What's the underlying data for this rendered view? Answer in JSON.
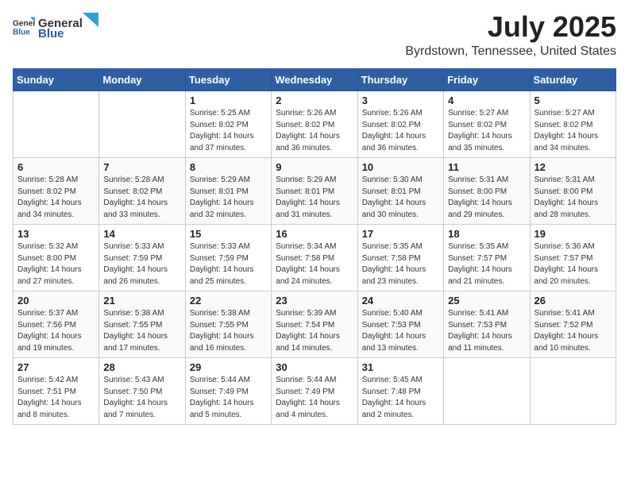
{
  "header": {
    "logo_general": "General",
    "logo_blue": "Blue",
    "month": "July 2025",
    "location": "Byrdstown, Tennessee, United States"
  },
  "weekdays": [
    "Sunday",
    "Monday",
    "Tuesday",
    "Wednesday",
    "Thursday",
    "Friday",
    "Saturday"
  ],
  "weeks": [
    [
      null,
      null,
      {
        "day": "1",
        "sunrise": "5:25 AM",
        "sunset": "8:02 PM",
        "daylight": "14 hours and 37 minutes."
      },
      {
        "day": "2",
        "sunrise": "5:26 AM",
        "sunset": "8:02 PM",
        "daylight": "14 hours and 36 minutes."
      },
      {
        "day": "3",
        "sunrise": "5:26 AM",
        "sunset": "8:02 PM",
        "daylight": "14 hours and 36 minutes."
      },
      {
        "day": "4",
        "sunrise": "5:27 AM",
        "sunset": "8:02 PM",
        "daylight": "14 hours and 35 minutes."
      },
      {
        "day": "5",
        "sunrise": "5:27 AM",
        "sunset": "8:02 PM",
        "daylight": "14 hours and 34 minutes."
      }
    ],
    [
      {
        "day": "6",
        "sunrise": "5:28 AM",
        "sunset": "8:02 PM",
        "daylight": "14 hours and 34 minutes."
      },
      {
        "day": "7",
        "sunrise": "5:28 AM",
        "sunset": "8:02 PM",
        "daylight": "14 hours and 33 minutes."
      },
      {
        "day": "8",
        "sunrise": "5:29 AM",
        "sunset": "8:01 PM",
        "daylight": "14 hours and 32 minutes."
      },
      {
        "day": "9",
        "sunrise": "5:29 AM",
        "sunset": "8:01 PM",
        "daylight": "14 hours and 31 minutes."
      },
      {
        "day": "10",
        "sunrise": "5:30 AM",
        "sunset": "8:01 PM",
        "daylight": "14 hours and 30 minutes."
      },
      {
        "day": "11",
        "sunrise": "5:31 AM",
        "sunset": "8:00 PM",
        "daylight": "14 hours and 29 minutes."
      },
      {
        "day": "12",
        "sunrise": "5:31 AM",
        "sunset": "8:00 PM",
        "daylight": "14 hours and 28 minutes."
      }
    ],
    [
      {
        "day": "13",
        "sunrise": "5:32 AM",
        "sunset": "8:00 PM",
        "daylight": "14 hours and 27 minutes."
      },
      {
        "day": "14",
        "sunrise": "5:33 AM",
        "sunset": "7:59 PM",
        "daylight": "14 hours and 26 minutes."
      },
      {
        "day": "15",
        "sunrise": "5:33 AM",
        "sunset": "7:59 PM",
        "daylight": "14 hours and 25 minutes."
      },
      {
        "day": "16",
        "sunrise": "5:34 AM",
        "sunset": "7:58 PM",
        "daylight": "14 hours and 24 minutes."
      },
      {
        "day": "17",
        "sunrise": "5:35 AM",
        "sunset": "7:58 PM",
        "daylight": "14 hours and 23 minutes."
      },
      {
        "day": "18",
        "sunrise": "5:35 AM",
        "sunset": "7:57 PM",
        "daylight": "14 hours and 21 minutes."
      },
      {
        "day": "19",
        "sunrise": "5:36 AM",
        "sunset": "7:57 PM",
        "daylight": "14 hours and 20 minutes."
      }
    ],
    [
      {
        "day": "20",
        "sunrise": "5:37 AM",
        "sunset": "7:56 PM",
        "daylight": "14 hours and 19 minutes."
      },
      {
        "day": "21",
        "sunrise": "5:38 AM",
        "sunset": "7:55 PM",
        "daylight": "14 hours and 17 minutes."
      },
      {
        "day": "22",
        "sunrise": "5:38 AM",
        "sunset": "7:55 PM",
        "daylight": "14 hours and 16 minutes."
      },
      {
        "day": "23",
        "sunrise": "5:39 AM",
        "sunset": "7:54 PM",
        "daylight": "14 hours and 14 minutes."
      },
      {
        "day": "24",
        "sunrise": "5:40 AM",
        "sunset": "7:53 PM",
        "daylight": "14 hours and 13 minutes."
      },
      {
        "day": "25",
        "sunrise": "5:41 AM",
        "sunset": "7:53 PM",
        "daylight": "14 hours and 11 minutes."
      },
      {
        "day": "26",
        "sunrise": "5:41 AM",
        "sunset": "7:52 PM",
        "daylight": "14 hours and 10 minutes."
      }
    ],
    [
      {
        "day": "27",
        "sunrise": "5:42 AM",
        "sunset": "7:51 PM",
        "daylight": "14 hours and 8 minutes."
      },
      {
        "day": "28",
        "sunrise": "5:43 AM",
        "sunset": "7:50 PM",
        "daylight": "14 hours and 7 minutes."
      },
      {
        "day": "29",
        "sunrise": "5:44 AM",
        "sunset": "7:49 PM",
        "daylight": "14 hours and 5 minutes."
      },
      {
        "day": "30",
        "sunrise": "5:44 AM",
        "sunset": "7:49 PM",
        "daylight": "14 hours and 4 minutes."
      },
      {
        "day": "31",
        "sunrise": "5:45 AM",
        "sunset": "7:48 PM",
        "daylight": "14 hours and 2 minutes."
      },
      null,
      null
    ]
  ],
  "labels": {
    "sunrise": "Sunrise:",
    "sunset": "Sunset:",
    "daylight": "Daylight:"
  }
}
